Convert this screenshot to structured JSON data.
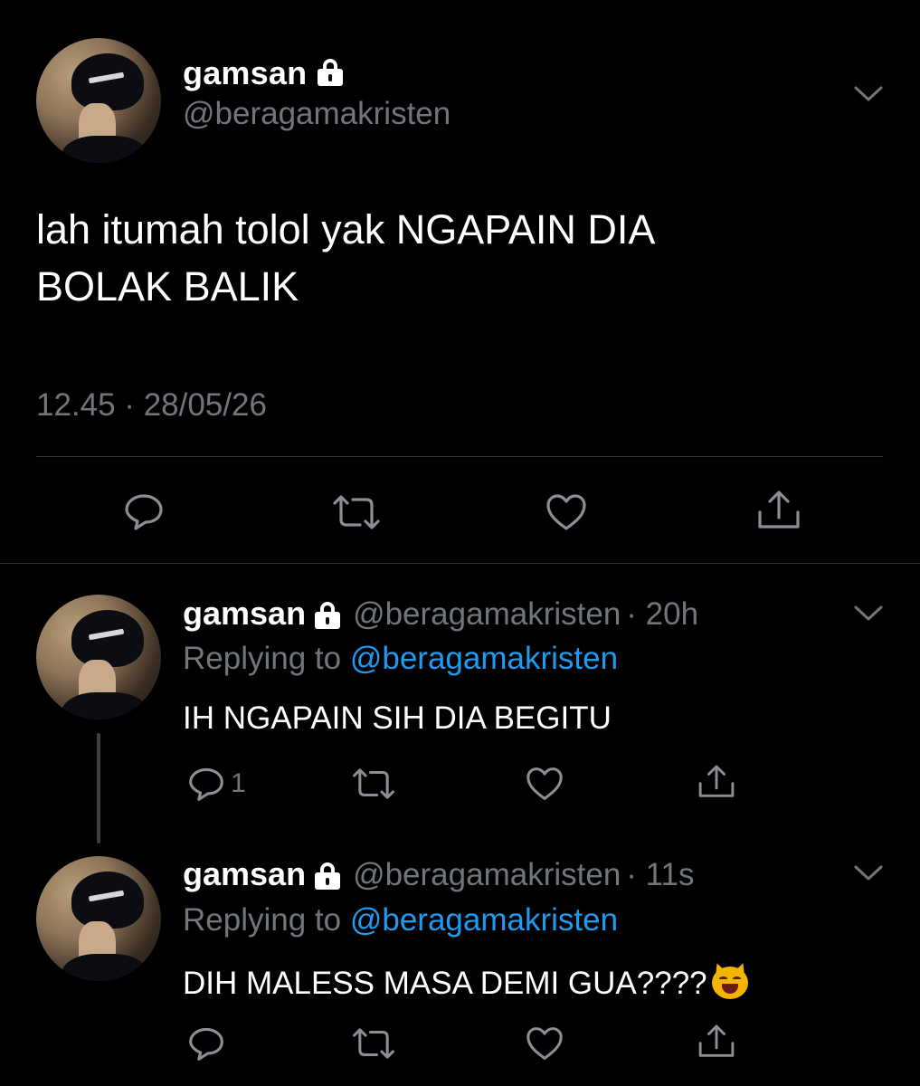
{
  "main_tweet": {
    "display_name": "gamsan",
    "handle": "@beragamakristen",
    "text_line1": "lah itumah tolol yak NGAPAIN DIA",
    "text_line2": "BOLAK BALIK",
    "timestamp": "12.45 · 28/05/26",
    "icons": [
      "reply-icon",
      "retweet-icon",
      "like-icon",
      "share-icon"
    ]
  },
  "replies": [
    {
      "display_name": "gamsan",
      "handle": "@beragamakristen",
      "time": "· 20h",
      "replying_prefix": "Replying to",
      "replying_to": "@beragamakristen",
      "text": "IH NGAPAIN SIH DIA BEGITU",
      "reply_count": "1"
    },
    {
      "display_name": "gamsan",
      "handle": "@beragamakristen",
      "time": "· 11s",
      "replying_prefix": "Replying to",
      "replying_to": "@beragamakristen",
      "text": "DIH MALESS MASA DEMI GUA????",
      "emoji": "grinning-cat-face"
    }
  ],
  "colors": {
    "background": "#000000",
    "text": "#ffffff",
    "secondary": "#71767b",
    "link": "#1d9bf0",
    "divider": "#2f3336"
  }
}
